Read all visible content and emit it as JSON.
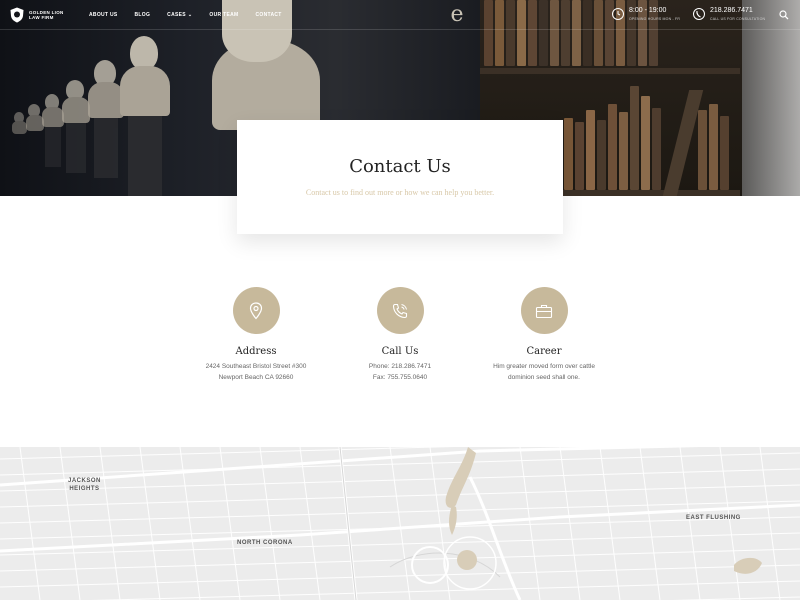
{
  "nav": {
    "logo_line1": "GOLDEN LION",
    "logo_line2": "LAW FIRM",
    "items": [
      {
        "label": "ABOUT US"
      },
      {
        "label": "BLOG"
      },
      {
        "label": "CASES"
      },
      {
        "label": "OUR TEAM"
      },
      {
        "label": "CONTACT"
      }
    ],
    "brand_glyph": "e",
    "hours_main": "8:00 - 19:00",
    "hours_sub": "OPENING HOURS MON - FR",
    "phone_main": "218.286.7471",
    "phone_sub": "CALL US FOR CONSULTATION",
    "icons": {
      "logo": "shield-lion-icon",
      "hours": "clock-icon",
      "phone": "phone-icon",
      "search": "search-icon",
      "cases": "chevron-down-icon"
    }
  },
  "card": {
    "title": "Contact Us",
    "subtitle": "Contact us to find out more or how we can help you better."
  },
  "columns": [
    {
      "icon": "map-pin-icon",
      "title": "Address",
      "line1": "2424 Southeast Bristol Street #300",
      "line2": "Newport Beach CA 92660"
    },
    {
      "icon": "phone-icon",
      "title": "Call Us",
      "line1": "Phone: 218.286.7471",
      "line2": "Fax: 755.755.0640"
    },
    {
      "icon": "briefcase-icon",
      "title": "Career",
      "line1": "Him greater moved form over cattle",
      "line2": "dominion seed shall one."
    }
  ],
  "map": {
    "labels": [
      {
        "line1": "JACKSON",
        "line2": "HEIGHTS"
      },
      {
        "line1": "NORTH CORONA",
        "line2": ""
      },
      {
        "line1": "EAST FLUSHING",
        "line2": ""
      }
    ]
  },
  "colors": {
    "accent": "#c7b99b",
    "accent_text": "#d8c8a8",
    "dark": "#15171c"
  }
}
